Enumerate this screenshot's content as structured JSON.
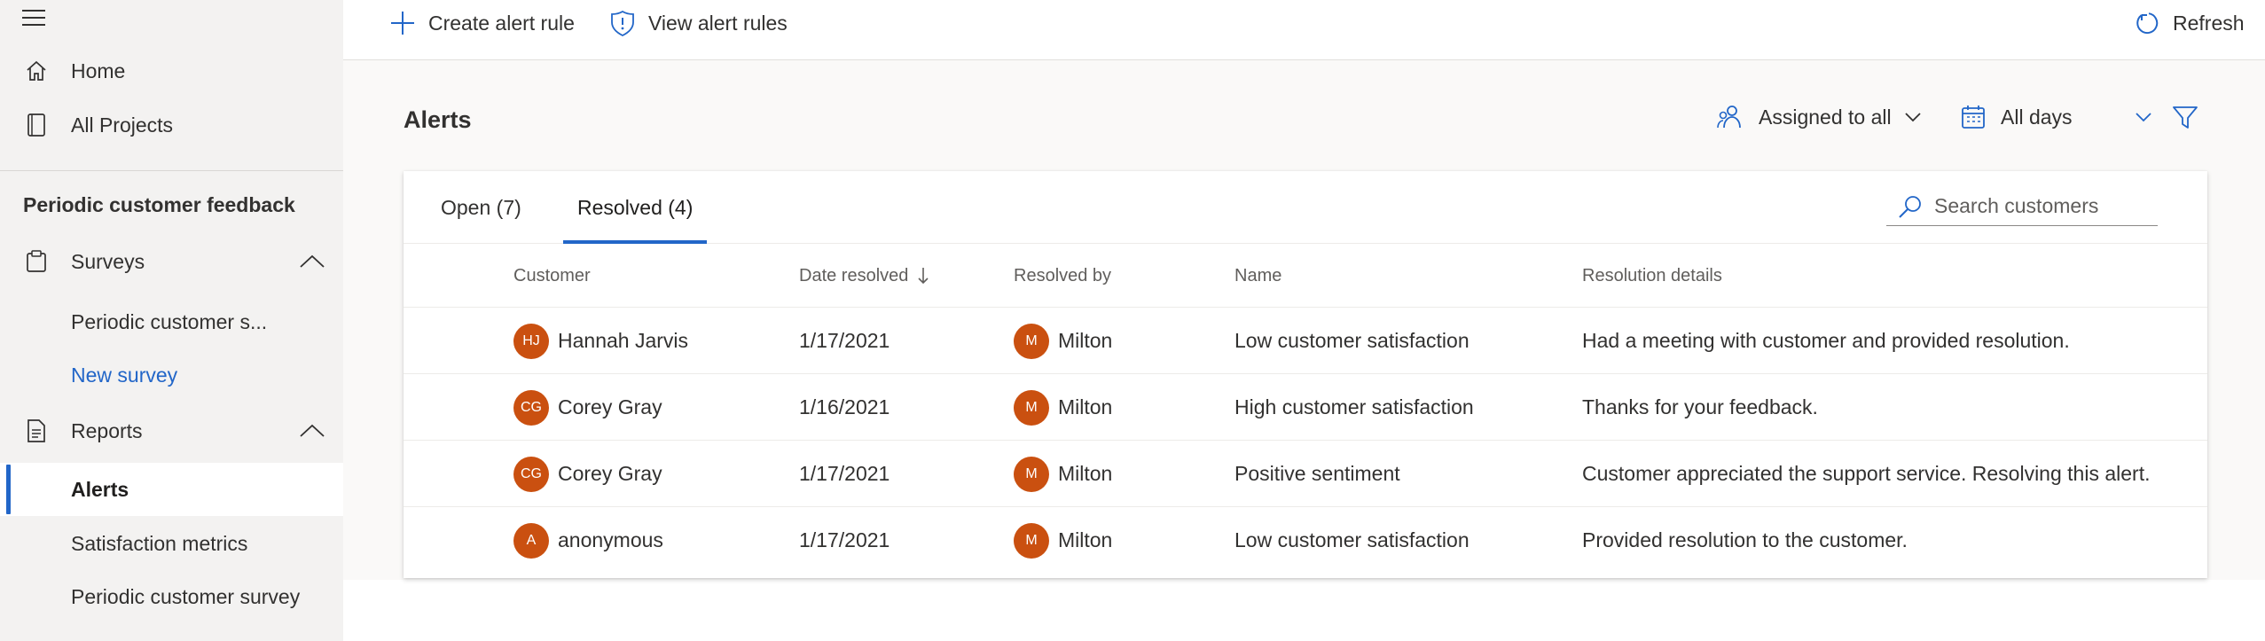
{
  "sidebar": {
    "home": "Home",
    "all_projects": "All Projects",
    "project_title": "Periodic customer feedback",
    "surveys": "Surveys",
    "survey_items": [
      "Periodic customer s...",
      "New survey"
    ],
    "reports": "Reports",
    "report_items": [
      "Alerts",
      "Satisfaction metrics",
      "Periodic customer survey"
    ]
  },
  "toolbar": {
    "create_alert_rule": "Create alert rule",
    "view_alert_rules": "View alert rules",
    "refresh": "Refresh"
  },
  "main": {
    "title": "Alerts",
    "assigned_filter": "Assigned to all",
    "date_filter": "All days"
  },
  "tabs": {
    "open": "Open (7)",
    "resolved": "Resolved (4)"
  },
  "search": {
    "placeholder": "Search customers"
  },
  "table": {
    "headers": {
      "customer": "Customer",
      "date_resolved": "Date resolved",
      "resolved_by": "Resolved by",
      "name": "Name",
      "resolution_details": "Resolution details"
    },
    "rows": [
      {
        "initials": "HJ",
        "customer": "Hannah Jarvis",
        "date": "1/17/2021",
        "by_initial": "M",
        "by": "Milton",
        "name": "Low customer satisfaction",
        "details": "Had a meeting with customer and provided resolution."
      },
      {
        "initials": "CG",
        "customer": "Corey Gray",
        "date": "1/16/2021",
        "by_initial": "M",
        "by": "Milton",
        "name": "High customer satisfaction",
        "details": "Thanks for your feedback."
      },
      {
        "initials": "CG",
        "customer": "Corey Gray",
        "date": "1/17/2021",
        "by_initial": "M",
        "by": "Milton",
        "name": "Positive sentiment",
        "details": "Customer appreciated the support service. Resolving this alert."
      },
      {
        "initials": "A",
        "customer": "anonymous",
        "date": "1/17/2021",
        "by_initial": "M",
        "by": "Milton",
        "name": "Low customer satisfaction",
        "details": "Provided resolution to the customer."
      }
    ]
  },
  "colors": {
    "accent": "#2266c8",
    "avatar": "#ca5010",
    "sidebar_bg": "#f3f2f1"
  },
  "icons": {
    "menu": "hamburger-icon",
    "home": "home-icon",
    "projects": "document-icon",
    "surveys": "clipboard-icon",
    "reports": "report-icon",
    "add": "plus-icon",
    "shield": "shield-icon",
    "refresh": "refresh-icon",
    "people": "people-icon",
    "calendar": "calendar-icon",
    "filter": "filter-icon",
    "search": "search-icon"
  }
}
